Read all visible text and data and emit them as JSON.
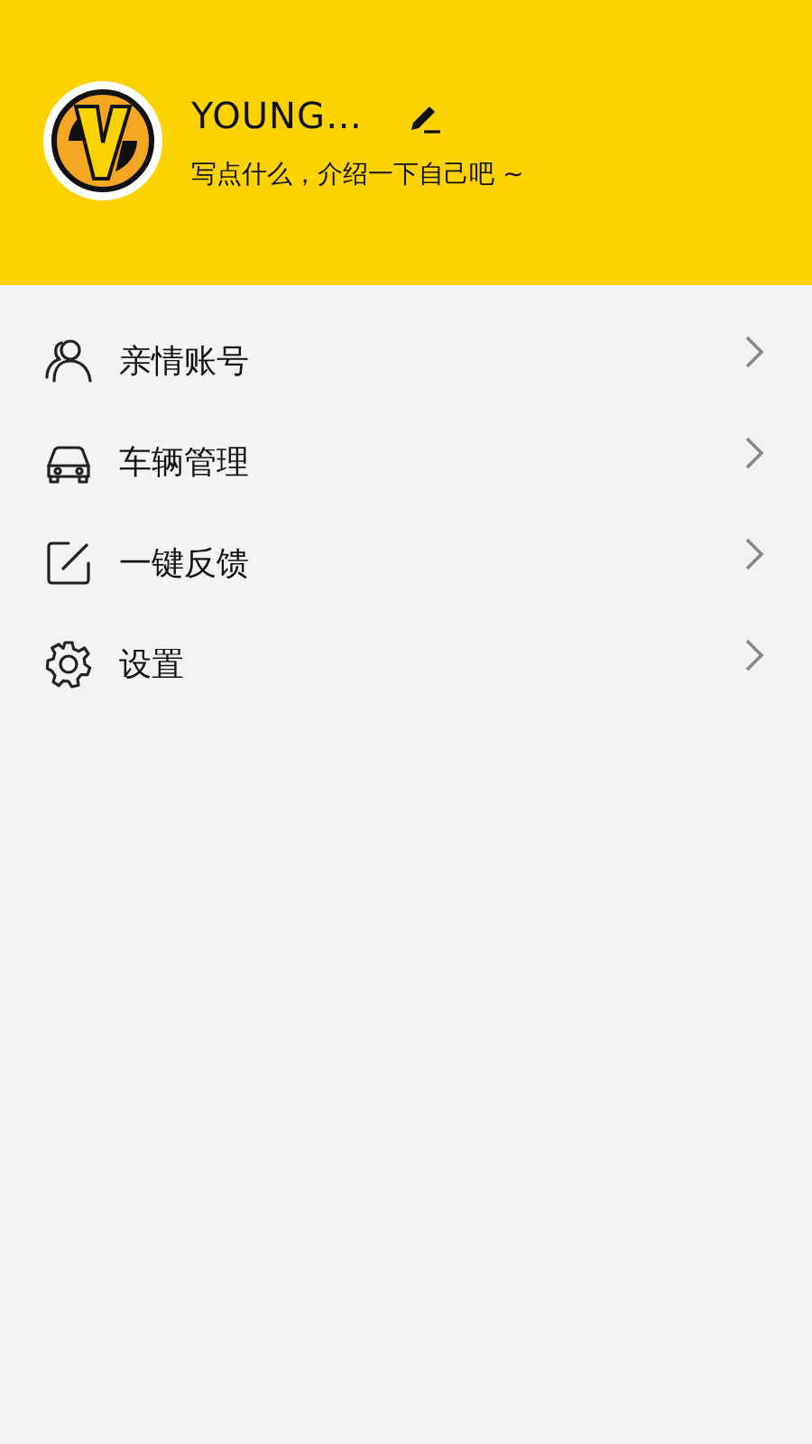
{
  "profile": {
    "name": "YOUNG…",
    "bio": "写点什么，介绍一下自己吧 ~"
  },
  "menu": [
    {
      "kind": "family",
      "label": "亲情账号"
    },
    {
      "kind": "car",
      "label": "车辆管理"
    },
    {
      "kind": "feedback",
      "label": "一键反馈"
    },
    {
      "kind": "settings",
      "label": "设置"
    }
  ]
}
